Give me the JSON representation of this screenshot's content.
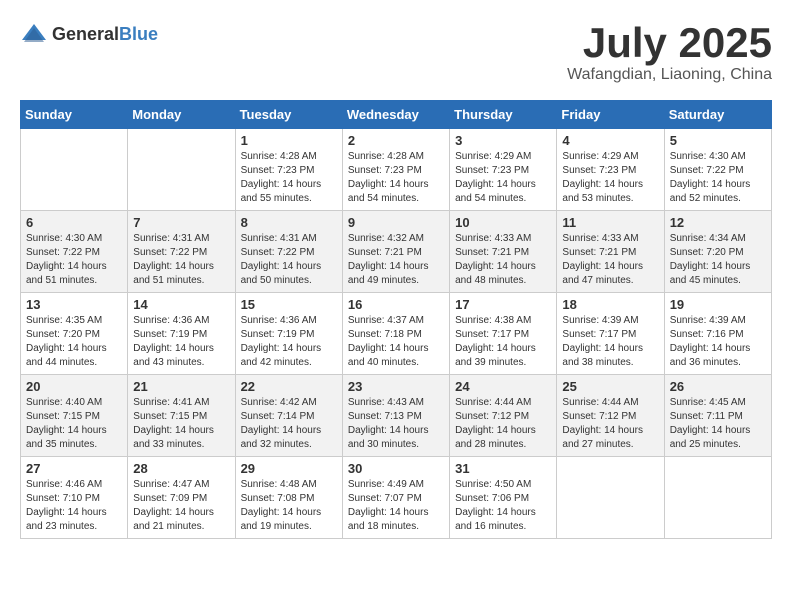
{
  "logo": {
    "general": "General",
    "blue": "Blue"
  },
  "header": {
    "month": "July 2025",
    "location": "Wafangdian, Liaoning, China"
  },
  "weekdays": [
    "Sunday",
    "Monday",
    "Tuesday",
    "Wednesday",
    "Thursday",
    "Friday",
    "Saturday"
  ],
  "weeks": [
    [
      {
        "day": "",
        "info": ""
      },
      {
        "day": "",
        "info": ""
      },
      {
        "day": "1",
        "info": "Sunrise: 4:28 AM\nSunset: 7:23 PM\nDaylight: 14 hours and 55 minutes."
      },
      {
        "day": "2",
        "info": "Sunrise: 4:28 AM\nSunset: 7:23 PM\nDaylight: 14 hours and 54 minutes."
      },
      {
        "day": "3",
        "info": "Sunrise: 4:29 AM\nSunset: 7:23 PM\nDaylight: 14 hours and 54 minutes."
      },
      {
        "day": "4",
        "info": "Sunrise: 4:29 AM\nSunset: 7:23 PM\nDaylight: 14 hours and 53 minutes."
      },
      {
        "day": "5",
        "info": "Sunrise: 4:30 AM\nSunset: 7:22 PM\nDaylight: 14 hours and 52 minutes."
      }
    ],
    [
      {
        "day": "6",
        "info": "Sunrise: 4:30 AM\nSunset: 7:22 PM\nDaylight: 14 hours and 51 minutes."
      },
      {
        "day": "7",
        "info": "Sunrise: 4:31 AM\nSunset: 7:22 PM\nDaylight: 14 hours and 51 minutes."
      },
      {
        "day": "8",
        "info": "Sunrise: 4:31 AM\nSunset: 7:22 PM\nDaylight: 14 hours and 50 minutes."
      },
      {
        "day": "9",
        "info": "Sunrise: 4:32 AM\nSunset: 7:21 PM\nDaylight: 14 hours and 49 minutes."
      },
      {
        "day": "10",
        "info": "Sunrise: 4:33 AM\nSunset: 7:21 PM\nDaylight: 14 hours and 48 minutes."
      },
      {
        "day": "11",
        "info": "Sunrise: 4:33 AM\nSunset: 7:21 PM\nDaylight: 14 hours and 47 minutes."
      },
      {
        "day": "12",
        "info": "Sunrise: 4:34 AM\nSunset: 7:20 PM\nDaylight: 14 hours and 45 minutes."
      }
    ],
    [
      {
        "day": "13",
        "info": "Sunrise: 4:35 AM\nSunset: 7:20 PM\nDaylight: 14 hours and 44 minutes."
      },
      {
        "day": "14",
        "info": "Sunrise: 4:36 AM\nSunset: 7:19 PM\nDaylight: 14 hours and 43 minutes."
      },
      {
        "day": "15",
        "info": "Sunrise: 4:36 AM\nSunset: 7:19 PM\nDaylight: 14 hours and 42 minutes."
      },
      {
        "day": "16",
        "info": "Sunrise: 4:37 AM\nSunset: 7:18 PM\nDaylight: 14 hours and 40 minutes."
      },
      {
        "day": "17",
        "info": "Sunrise: 4:38 AM\nSunset: 7:17 PM\nDaylight: 14 hours and 39 minutes."
      },
      {
        "day": "18",
        "info": "Sunrise: 4:39 AM\nSunset: 7:17 PM\nDaylight: 14 hours and 38 minutes."
      },
      {
        "day": "19",
        "info": "Sunrise: 4:39 AM\nSunset: 7:16 PM\nDaylight: 14 hours and 36 minutes."
      }
    ],
    [
      {
        "day": "20",
        "info": "Sunrise: 4:40 AM\nSunset: 7:15 PM\nDaylight: 14 hours and 35 minutes."
      },
      {
        "day": "21",
        "info": "Sunrise: 4:41 AM\nSunset: 7:15 PM\nDaylight: 14 hours and 33 minutes."
      },
      {
        "day": "22",
        "info": "Sunrise: 4:42 AM\nSunset: 7:14 PM\nDaylight: 14 hours and 32 minutes."
      },
      {
        "day": "23",
        "info": "Sunrise: 4:43 AM\nSunset: 7:13 PM\nDaylight: 14 hours and 30 minutes."
      },
      {
        "day": "24",
        "info": "Sunrise: 4:44 AM\nSunset: 7:12 PM\nDaylight: 14 hours and 28 minutes."
      },
      {
        "day": "25",
        "info": "Sunrise: 4:44 AM\nSunset: 7:12 PM\nDaylight: 14 hours and 27 minutes."
      },
      {
        "day": "26",
        "info": "Sunrise: 4:45 AM\nSunset: 7:11 PM\nDaylight: 14 hours and 25 minutes."
      }
    ],
    [
      {
        "day": "27",
        "info": "Sunrise: 4:46 AM\nSunset: 7:10 PM\nDaylight: 14 hours and 23 minutes."
      },
      {
        "day": "28",
        "info": "Sunrise: 4:47 AM\nSunset: 7:09 PM\nDaylight: 14 hours and 21 minutes."
      },
      {
        "day": "29",
        "info": "Sunrise: 4:48 AM\nSunset: 7:08 PM\nDaylight: 14 hours and 19 minutes."
      },
      {
        "day": "30",
        "info": "Sunrise: 4:49 AM\nSunset: 7:07 PM\nDaylight: 14 hours and 18 minutes."
      },
      {
        "day": "31",
        "info": "Sunrise: 4:50 AM\nSunset: 7:06 PM\nDaylight: 14 hours and 16 minutes."
      },
      {
        "day": "",
        "info": ""
      },
      {
        "day": "",
        "info": ""
      }
    ]
  ]
}
